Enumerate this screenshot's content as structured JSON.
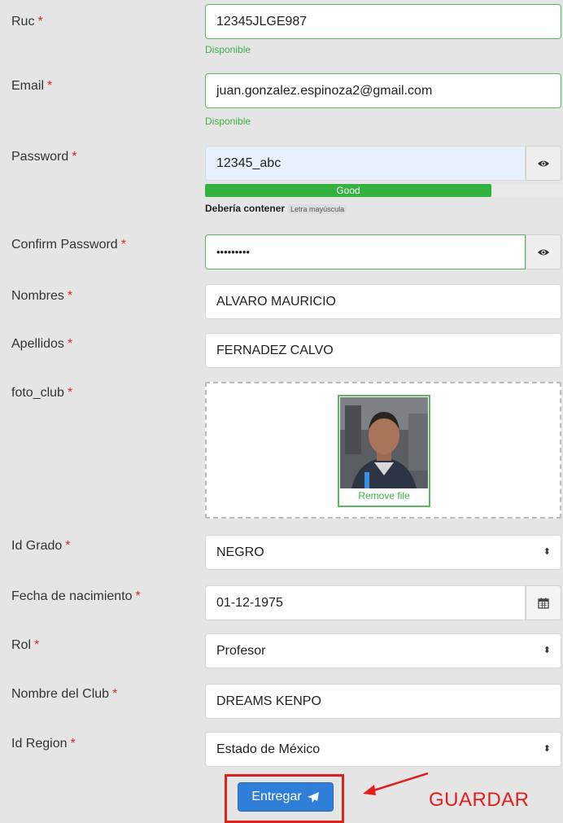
{
  "form": {
    "ruc": {
      "label": "Ruc",
      "value": "12345JLGE987",
      "status": "Disponible"
    },
    "email": {
      "label": "Email",
      "value": "juan.gonzalez.espinoza2@gmail.com",
      "status": "Disponible"
    },
    "password": {
      "label": "Password",
      "value": "12345_abc",
      "strength_label": "Good",
      "strength_level": 0.8,
      "hint_label": "Debería contener",
      "hint_tag": "Letra mayúscula",
      "toggle_icon": "eye-icon"
    },
    "confirm_password": {
      "label": "Confirm Password",
      "value": "•••••••••",
      "toggle_icon": "eye-icon"
    },
    "nombres": {
      "label": "Nombres",
      "value": "ALVARO MAURICIO"
    },
    "apellidos": {
      "label": "Apellidos",
      "value": "FERNADEZ CALVO"
    },
    "foto_club": {
      "label": "foto_club",
      "remove_label": "Remove file"
    },
    "id_grado": {
      "label": "Id Grado",
      "value": "NEGRO"
    },
    "fecha_nacimiento": {
      "label": "Fecha de nacimiento",
      "value": "01-12-1975",
      "icon": "calendar-icon"
    },
    "rol": {
      "label": "Rol",
      "value": "Profesor"
    },
    "nombre_club": {
      "label": "Nombre del Club",
      "value": "DREAMS KENPO"
    },
    "id_region": {
      "label": "Id Region",
      "value": "Estado de México"
    },
    "required_mark": "*",
    "submit_label": "Entregar",
    "annotation_text": "GUARDAR"
  },
  "colors": {
    "required": "#e0262b",
    "valid": "#3cb043",
    "primary": "#2f7fd9",
    "highlight": "#e0201c"
  }
}
